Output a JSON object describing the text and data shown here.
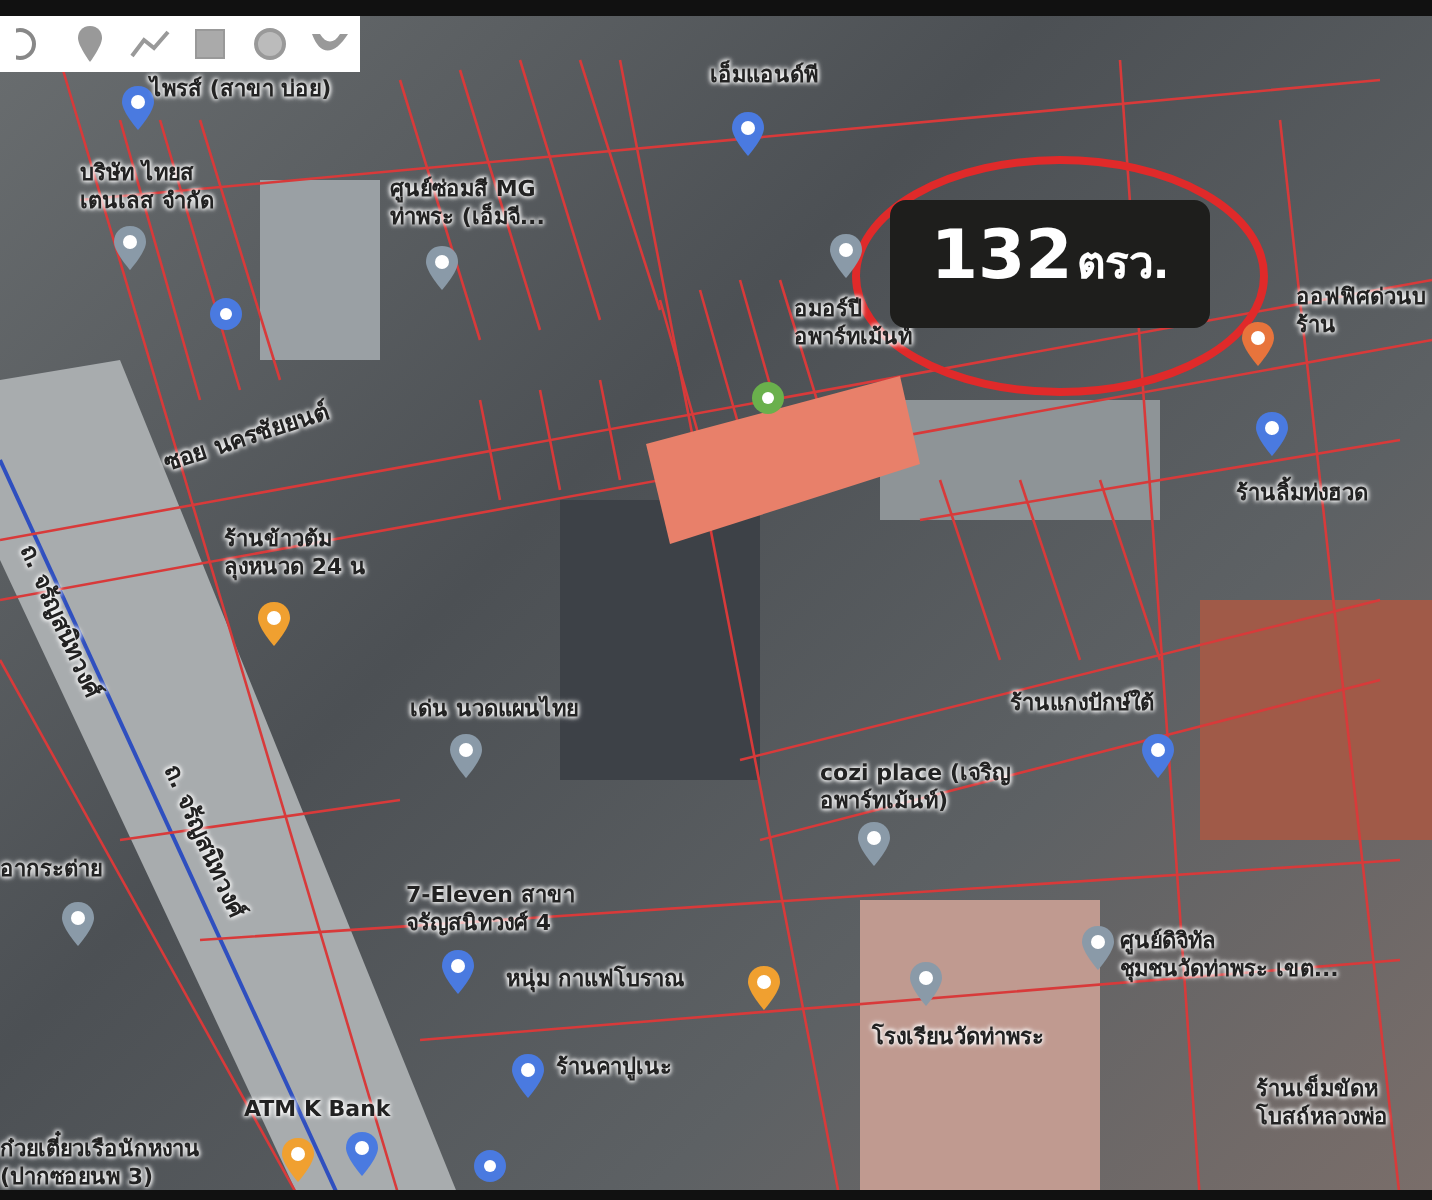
{
  "toolbar": {
    "tools": [
      {
        "kind": "circle-partial"
      },
      {
        "kind": "pin"
      },
      {
        "kind": "line"
      },
      {
        "kind": "square"
      },
      {
        "kind": "circle"
      },
      {
        "kind": "curve"
      }
    ]
  },
  "area_label": {
    "value": "132",
    "unit": "ตรว."
  },
  "roads": [
    {
      "name": "ถ. จรัญสนิทวงศ์"
    },
    {
      "name": "ถ. จรัญสนิทวงศ์"
    },
    {
      "name": "ซอย นครชัยยนต์"
    }
  ],
  "places": [
    {
      "name": "ไพรส์ (สาขา บ่อย)",
      "color": "#4a7ae0"
    },
    {
      "name": "บริษัท ไทยส\nเตนเลส จำกัด",
      "color": "#8a9aa8"
    },
    {
      "name": "ศูนย์ซ่อมสี MG\nท่าพระ (เอ็มจี...",
      "color": "#8a9aa8"
    },
    {
      "name": "เอ็มแอนด์พี",
      "color": "#4a7ae0"
    },
    {
      "name": "อมอร์ปี\nอพาร์ทเม้นท์",
      "color": "#8a9aa8"
    },
    {
      "name": "ออฟฟิศด่วนบ\nร้าน",
      "color": "#e8743c"
    },
    {
      "name": "ร้านลิ้มท่งฮวด",
      "color": "#4a7ae0"
    },
    {
      "name": "ร้านข้าวต้ม\nลุงหนวด 24 น",
      "color": "#f0a030"
    },
    {
      "name": "เด่น นวดแผนไทย",
      "color": "#8a9aa8"
    },
    {
      "name": "ร้านแกงปักษ์ใต้",
      "color": "#4a7ae0"
    },
    {
      "name": "cozi place (เจริญ\nอพาร์ทเม้นท์)",
      "color": "#8a9aa8"
    },
    {
      "name": "อากระต่าย",
      "color": "#8a9aa8"
    },
    {
      "name": "7-Eleven สาขา\nจรัญสนิทวงศ์ 4",
      "color": "#4a7ae0"
    },
    {
      "name": "หนุ่ม กาแฟโบราณ",
      "color": "#f0a030"
    },
    {
      "name": "ศูนย์ดิจิทัล\nชุมชนวัดท่าพระ เขต...",
      "color": "#8a9aa8"
    },
    {
      "name": "ร้านคาปูเนะ",
      "color": "#4a7ae0"
    },
    {
      "name": "โรงเรียนวัดท่าพระ",
      "color": "#8a9aa8"
    },
    {
      "name": "ATM K Bank",
      "color": "#4a7ae0"
    },
    {
      "name": "ก๋วยเตี๋ยวเรือนักหงาน\n(ปากซอยนพ 3)",
      "color": "#f0a030"
    },
    {
      "name": "ร้านเข็มขัดห\nโบสถ์หลวงพ่อ"
    }
  ],
  "markers": [
    {
      "color": "#4a7ae0"
    },
    {
      "color": "#6ab04c"
    },
    {
      "color": "#4a7ae0"
    }
  ]
}
